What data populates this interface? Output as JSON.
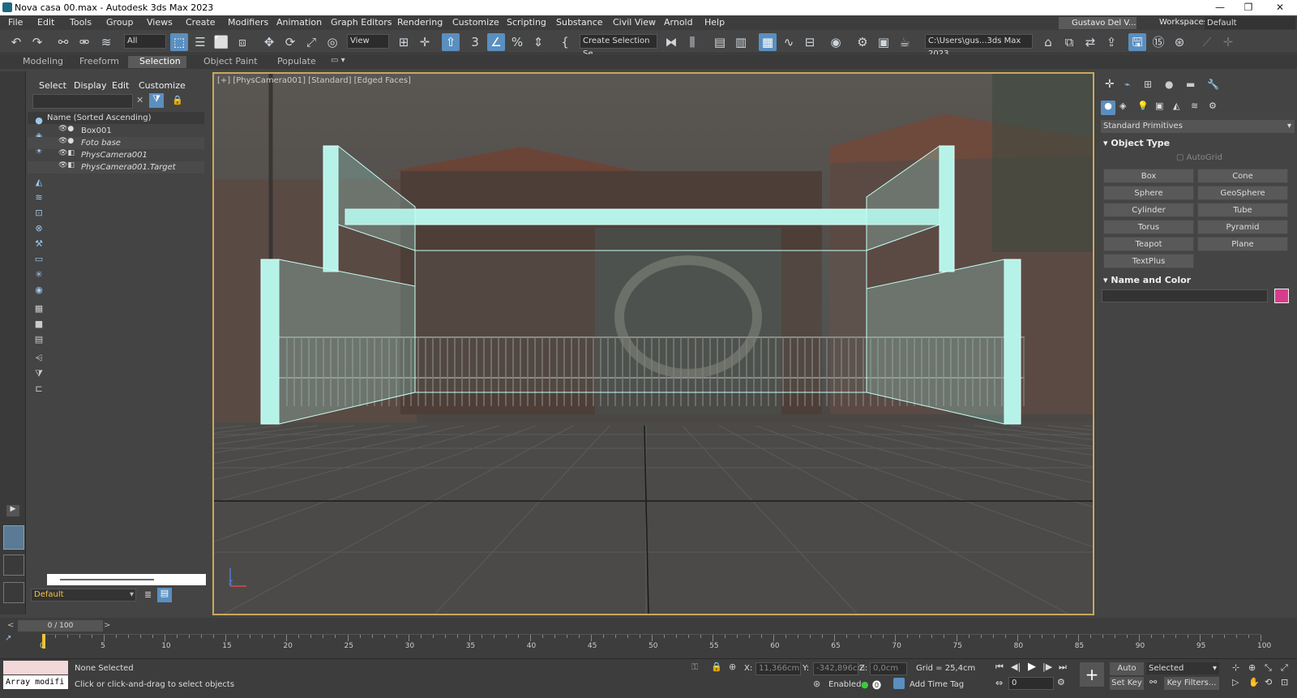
{
  "title": "Nova casa 00.max - Autodesk 3ds Max 2023",
  "menu": [
    "File",
    "Edit",
    "Tools",
    "Group",
    "Views",
    "Create",
    "Modifiers",
    "Animation",
    "Graph Editors",
    "Rendering",
    "Customize",
    "Scripting",
    "Substance",
    "Civil View",
    "Arnold",
    "Help"
  ],
  "user": "Gustavo Del V...",
  "workspaces_label": "Workspaces:",
  "workspace": "Default",
  "toolbar": {
    "filter": "All",
    "view": "View",
    "selection_set": "Create Selection Se",
    "path": "C:\\Users\\gus...3ds Max 2023"
  },
  "ribbon": [
    "Modeling",
    "Freeform",
    "Selection",
    "Object Paint",
    "Populate"
  ],
  "scene_tabs": [
    "Select",
    "Display",
    "Edit",
    "Customize"
  ],
  "scene_header": "Name (Sorted Ascending)",
  "scene_items": [
    "Box001",
    "Foto base",
    "PhysCamera001",
    "PhysCamera001.Target"
  ],
  "layer": "Default",
  "viewport_label": "[+] [PhysCamera001] [Standard] [Edged Faces]",
  "panel": {
    "dropdown": "Standard Primitives",
    "object_type": "Object Type",
    "autogrid": "AutoGrid",
    "buttons": [
      "Box",
      "Cone",
      "Sphere",
      "GeoSphere",
      "Cylinder",
      "Tube",
      "Torus",
      "Pyramid",
      "Teapot",
      "Plane",
      "TextPlus"
    ],
    "name_color": "Name and Color",
    "color": "#d63c8c"
  },
  "timeline": {
    "frame": "0 / 100",
    "ticks": [
      "0",
      "5",
      "10",
      "15",
      "20",
      "25",
      "30",
      "35",
      "40",
      "45",
      "50",
      "55",
      "60",
      "65",
      "70",
      "75",
      "80",
      "85",
      "90",
      "95",
      "100"
    ]
  },
  "status": {
    "script": "Array modifi",
    "selected": "None Selected",
    "prompt": "Click or click-and-drag to select objects",
    "x": "11,366cm",
    "y": "-342,896cm",
    "z": "0,0cm",
    "grid": "Grid = 25,4cm",
    "enabled": "Enabled:",
    "addtime": "Add Time Tag",
    "autokey": "Auto Key",
    "setkey": "Set Key",
    "selected_dd": "Selected",
    "keyfilters": "Key Filters...",
    "frame_field": "0"
  }
}
